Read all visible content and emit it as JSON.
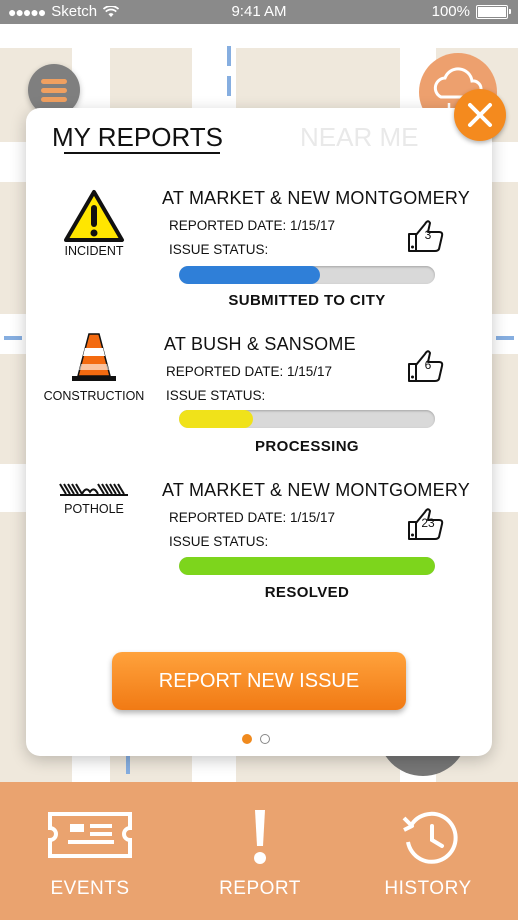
{
  "status_bar": {
    "carrier": "Sketch",
    "time": "9:41 AM",
    "battery": "100%"
  },
  "tabs": {
    "my_reports": "MY REPORTS",
    "near_me": "NEAR ME",
    "active": "my_reports"
  },
  "reports": [
    {
      "category": "INCIDENT",
      "category_icon": "warning-icon",
      "location": "AT MARKET & NEW MONTGOMERY",
      "date_text": "REPORTED DATE: 1/15/17",
      "status_label": "ISSUE STATUS:",
      "status": "SUBMITTED TO  CITY",
      "progress": 0.55,
      "bar_color": "#2f7fd8",
      "likes": "3"
    },
    {
      "category": "CONSTRUCTION",
      "category_icon": "traffic-cone-icon",
      "location": "AT BUSH & SANSOME",
      "date_text": "REPORTED DATE: 1/15/17",
      "status_label": "ISSUE STATUS:",
      "status": "PROCESSING",
      "progress": 0.29,
      "bar_color": "#f0e21a",
      "likes": "6"
    },
    {
      "category": "POTHOLE",
      "category_icon": "pothole-icon",
      "location": "AT MARKET & NEW MONTGOMERY",
      "date_text": "REPORTED DATE: 1/15/17",
      "status_label": "ISSUE STATUS:",
      "status": "RESOLVED",
      "progress": 1.0,
      "bar_color": "#7dd51c",
      "likes": "23"
    }
  ],
  "actions": {
    "report_new_issue": "REPORT NEW ISSUE"
  },
  "pager": {
    "pages": 2,
    "current": 1
  },
  "bottom_nav": [
    {
      "label": "EVENTS",
      "icon": "ticket-icon"
    },
    {
      "label": "REPORT",
      "icon": "exclamation-icon"
    },
    {
      "label": "HISTORY",
      "icon": "history-clock-icon"
    }
  ],
  "colors": {
    "accent": "#f48a1e",
    "tabbar": "#eaa36f",
    "map": "#efe8dc"
  }
}
